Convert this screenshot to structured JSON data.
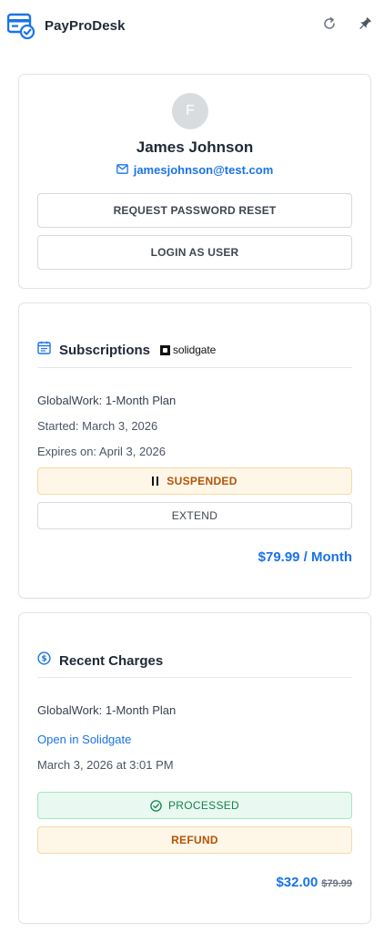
{
  "app": {
    "title": "PayProDesk"
  },
  "colors": {
    "accent": "#1a73e8",
    "warning": "#b45309",
    "success": "#16834f"
  },
  "profile": {
    "avatar_initial": "F",
    "name": "James Johnson",
    "email": "jamesjohnson@test.com",
    "reset_label": "REQUEST PASSWORD RESET",
    "login_label": "LOGIN AS USER"
  },
  "subscriptions": {
    "title": "Subscriptions",
    "provider": "solidgate",
    "plan": "GlobalWork: 1-Month Plan",
    "started": "Started: March 3, 2026",
    "expires": "Expires on: April 3, 2026",
    "status_label": "SUSPENDED",
    "extend_label": "EXTEND",
    "price": "$79.99 / Month"
  },
  "charges": {
    "title": "Recent Charges",
    "plan": "GlobalWork: 1-Month Plan",
    "link_label": "Open in Solidgate",
    "date": "March 3, 2026 at 3:01 PM",
    "status_label": "PROCESSED",
    "refund_label": "REFUND",
    "amount": "$32.00",
    "original_amount": "$79.99"
  }
}
